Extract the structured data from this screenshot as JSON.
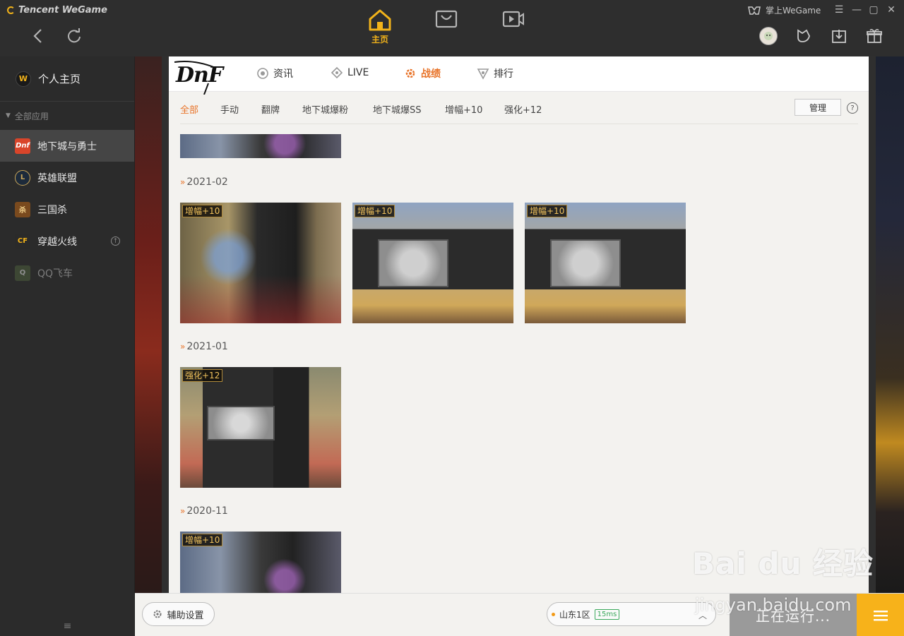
{
  "app": {
    "brand": "Tencent WeGame"
  },
  "topbar": {
    "home_label": "主页",
    "wegame_link": "掌上WeGame"
  },
  "sidebar": {
    "profile": "个人主页",
    "section": "全部应用",
    "games": [
      {
        "label": "地下城与勇士"
      },
      {
        "label": "英雄联盟"
      },
      {
        "label": "三国杀"
      },
      {
        "label": "穿越火线"
      },
      {
        "label": "QQ飞车"
      }
    ]
  },
  "gamenav": {
    "logo": "DnF",
    "tabs": [
      {
        "label": "资讯"
      },
      {
        "label": "LIVE"
      },
      {
        "label": "战绩"
      },
      {
        "label": "排行"
      }
    ]
  },
  "filters": {
    "items": [
      "全部",
      "手动",
      "翻牌",
      "地下城爆粉",
      "地下城爆SS",
      "增幅+10",
      "强化+12"
    ],
    "manage": "管理",
    "help": "?"
  },
  "months": [
    {
      "label": "2021-02",
      "tags": [
        "增幅+10",
        "增幅+10",
        "增幅+10"
      ]
    },
    {
      "label": "2021-01",
      "tags": [
        "强化+12"
      ]
    },
    {
      "label": "2020-11",
      "tags": [
        "增幅+10"
      ]
    }
  ],
  "bottombar": {
    "assist": "辅助设置",
    "server": "山东1区",
    "ping": "15ms",
    "running": "正在运行..."
  },
  "watermark": {
    "big": "Bai du 经验",
    "small": "jingyan.baidu.com"
  },
  "colors": {
    "accent": "#e8742a",
    "brand_yellow": "#f2b31a",
    "topbar": "#2e2e2e",
    "sidebar": "#2b2b2b",
    "active_item": "#454545"
  }
}
